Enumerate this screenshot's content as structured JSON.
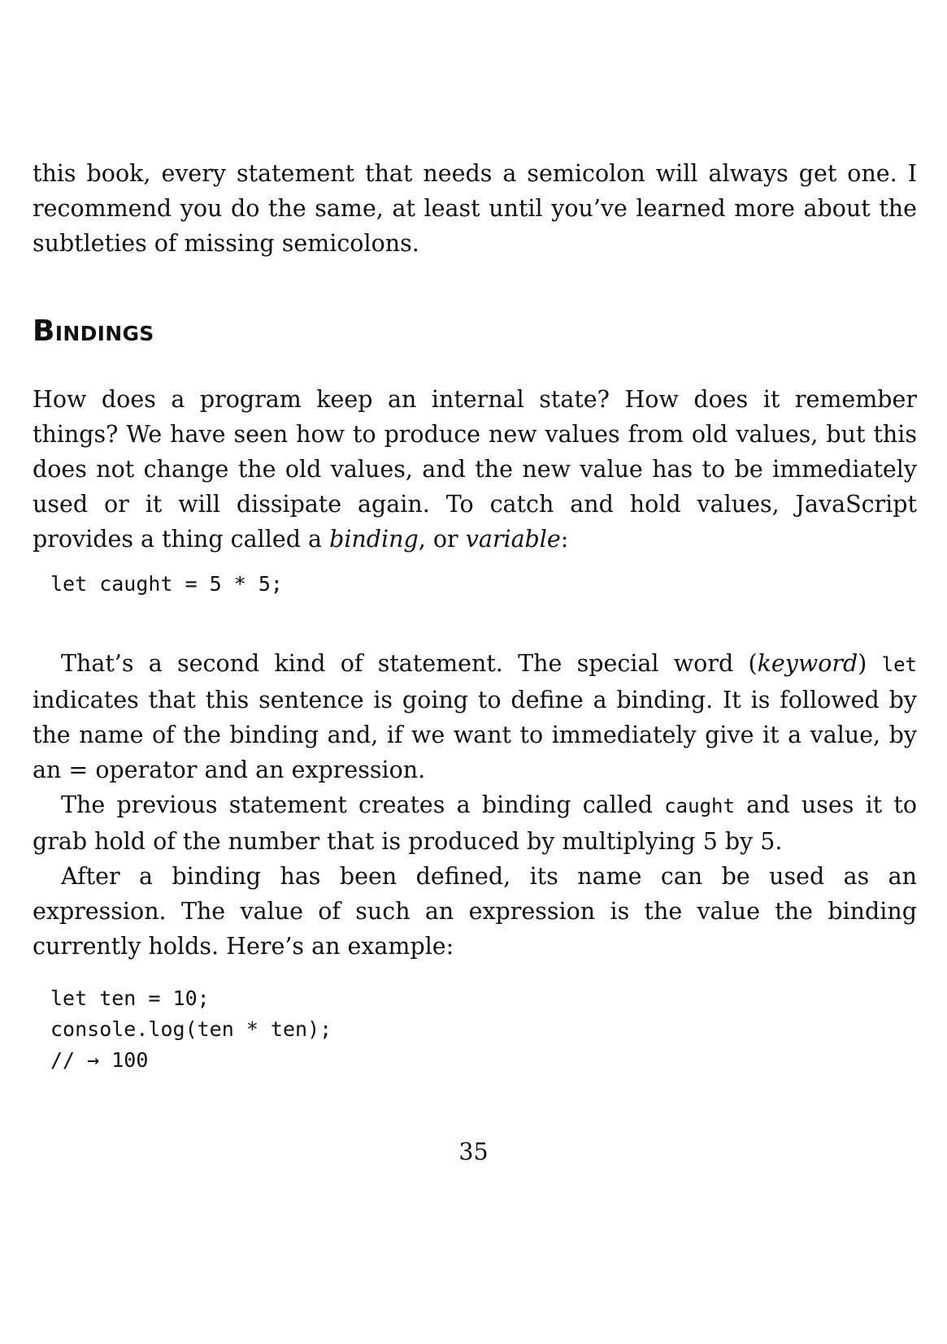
{
  "p1": "this book, every statement that needs a semicolon will always get one. I recommend you do the same, at least until you’ve learned more about the subtleties of missing semicolons.",
  "heading": "Bindings",
  "p2": {
    "text": "How does a program keep an internal state? How does it remember things? We have seen how to produce new values from old values, but this does not change the old values, and the new value has to be immediately used or it will dissipate again. To catch and hold values, JavaScript provides a thing called a ",
    "em1": "binding",
    "mid": ", or ",
    "em2": "variable",
    "end": ":"
  },
  "code1": [
    "let caught = 5 * 5;"
  ],
  "p3": {
    "a": "That’s a second kind of statement. The special word (",
    "em": "keyword",
    "b": ") ",
    "code": "let",
    "c": " indicates that this sentence is going to define a binding. It is followed by the name of the binding and, if we want to immediately give it a value, by an = operator and an expression."
  },
  "p4": {
    "a": "The previous statement creates a binding called ",
    "code": "caught",
    "b": " and uses it to grab hold of the number that is produced by multiplying 5 by 5."
  },
  "p5": "After a binding has been defined, its name can be used as an expression. The value of such an expression is the value the binding currently holds. Here’s an example:",
  "code2": [
    "let ten = 10;",
    "console.log(ten * ten);",
    "// → 100"
  ],
  "page_number": "35"
}
